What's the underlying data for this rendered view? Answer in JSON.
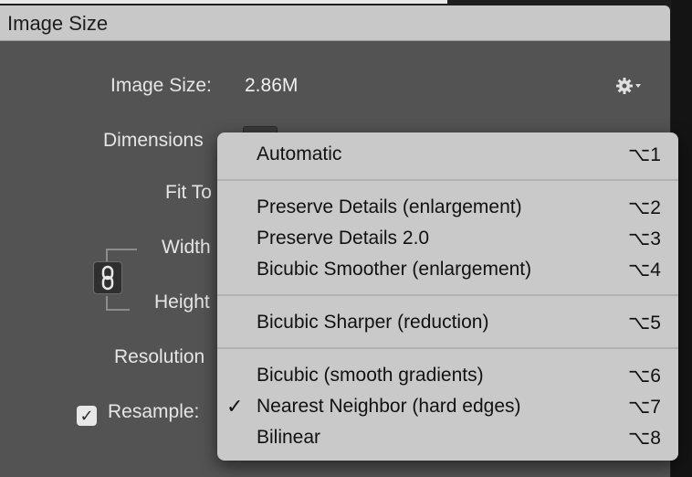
{
  "dialog": {
    "title": "Image Size",
    "image_size_label": "Image Size:",
    "image_size_value": "2.86M",
    "dimensions_label": "Dimensions",
    "fit_to_label": "Fit To",
    "width_label": "Width",
    "height_label": "Height",
    "resolution_label": "Resolution",
    "resample_label": "Resample:",
    "resample_checked": true
  },
  "menu": {
    "items": [
      {
        "label": "Automatic",
        "shortcut": "⌥1",
        "checked": false
      },
      {
        "label": "Preserve Details (enlargement)",
        "shortcut": "⌥2",
        "checked": false
      },
      {
        "label": "Preserve Details 2.0",
        "shortcut": "⌥3",
        "checked": false
      },
      {
        "label": "Bicubic Smoother (enlargement)",
        "shortcut": "⌥4",
        "checked": false
      },
      {
        "label": "Bicubic Sharper (reduction)",
        "shortcut": "⌥5",
        "checked": false
      },
      {
        "label": "Bicubic (smooth gradients)",
        "shortcut": "⌥6",
        "checked": false
      },
      {
        "label": "Nearest Neighbor (hard edges)",
        "shortcut": "⌥7",
        "checked": true,
        "check_mark": "✓"
      },
      {
        "label": "Bilinear",
        "shortcut": "⌥8",
        "checked": false
      }
    ]
  },
  "icons": {
    "settings": "gear-icon",
    "link": "chain-link-icon",
    "checkbox": "checkmark-icon"
  }
}
